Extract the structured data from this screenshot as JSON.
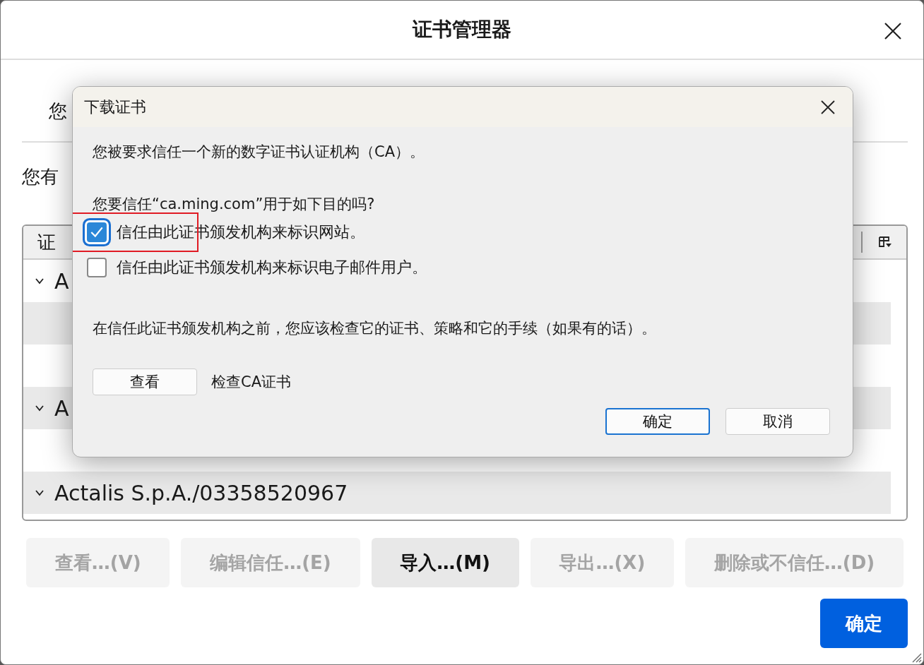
{
  "window": {
    "title": "证书管理器"
  },
  "tab_label": "您",
  "description": "您有",
  "tree": {
    "column_1": "证",
    "groups": [
      {
        "name": "A",
        "expanded": true
      },
      {
        "name": "A",
        "expanded": true
      },
      {
        "name": "Actalis S.p.A./03358520967",
        "expanded": true
      }
    ]
  },
  "buttons": [
    {
      "label": "查看…(V)",
      "disabled": true
    },
    {
      "label": "编辑信任…(E)",
      "disabled": true
    },
    {
      "label": "导入…(M)",
      "disabled": false
    },
    {
      "label": "导出…(X)",
      "disabled": true
    },
    {
      "label": "删除或不信任…(D)",
      "disabled": true
    }
  ],
  "ok_button": "确定",
  "dialog": {
    "title": "下载证书",
    "message": "您被要求信任一个新的数字证书认证机构（CA）。",
    "question": "您要信任“ca.ming.com”用于如下目的吗?",
    "options": [
      {
        "label": "信任由此证书颁发机构来标识网站。",
        "checked": true,
        "highlighted": true
      },
      {
        "label": "信任由此证书颁发机构来标识电子邮件用户。",
        "checked": false,
        "highlighted": false
      }
    ],
    "advice": "在信任此证书颁发机构之前，您应该检查它的证书、策略和它的手续（如果有的话）。",
    "view_button": "查看",
    "view_label": "检查CA证书",
    "buttons": [
      {
        "label": "确定",
        "kind": "default"
      },
      {
        "label": "取消",
        "kind": "normal"
      }
    ]
  }
}
